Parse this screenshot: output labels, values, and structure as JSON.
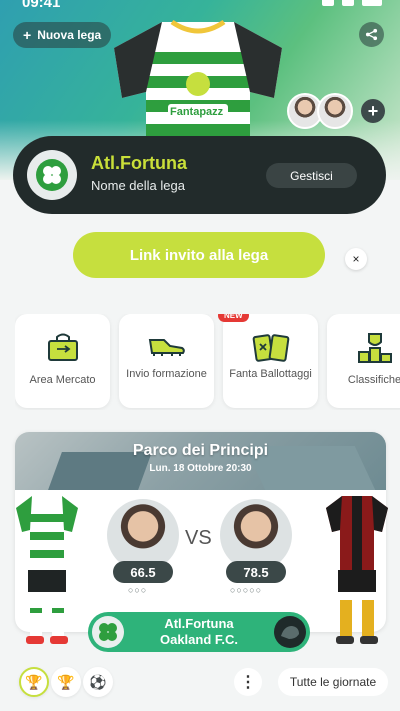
{
  "status_bar": {
    "time": "09:41"
  },
  "header": {
    "new_league_label": "Nuova lega",
    "jersey_brand": "Fantapazz"
  },
  "league": {
    "team_name": "Atl.Fortuna",
    "league_name": "Nome della lega",
    "manage_label": "Gestisci"
  },
  "invite": {
    "label": "Link invito alla lega",
    "close_symbol": "×"
  },
  "menu": {
    "items": [
      {
        "label": "Area Mercato",
        "icon": "market-bag-icon"
      },
      {
        "label": "Invio formazione",
        "icon": "boot-icon"
      },
      {
        "label": "Fanta Ballottaggi",
        "icon": "cards-icon",
        "badge": "NEW"
      },
      {
        "label": "Classifiche",
        "icon": "trophy-podium-icon"
      }
    ]
  },
  "match": {
    "venue": "Parco dei Principi",
    "datetime": "Lun. 18 Ottobre 20:30",
    "vs": "VS",
    "home_rating": "66.5",
    "away_rating": "78.5",
    "home_team": "Atl.Fortuna",
    "away_team": "Oakland F.C.",
    "colors": {
      "home_primary": "#2e9e3e",
      "away_primary": "#8a1a1a",
      "accent": "#c6df3e"
    }
  },
  "bottom_bar": {
    "all_rounds_label": "Tutte le giornate",
    "more_symbol": "⋮"
  }
}
